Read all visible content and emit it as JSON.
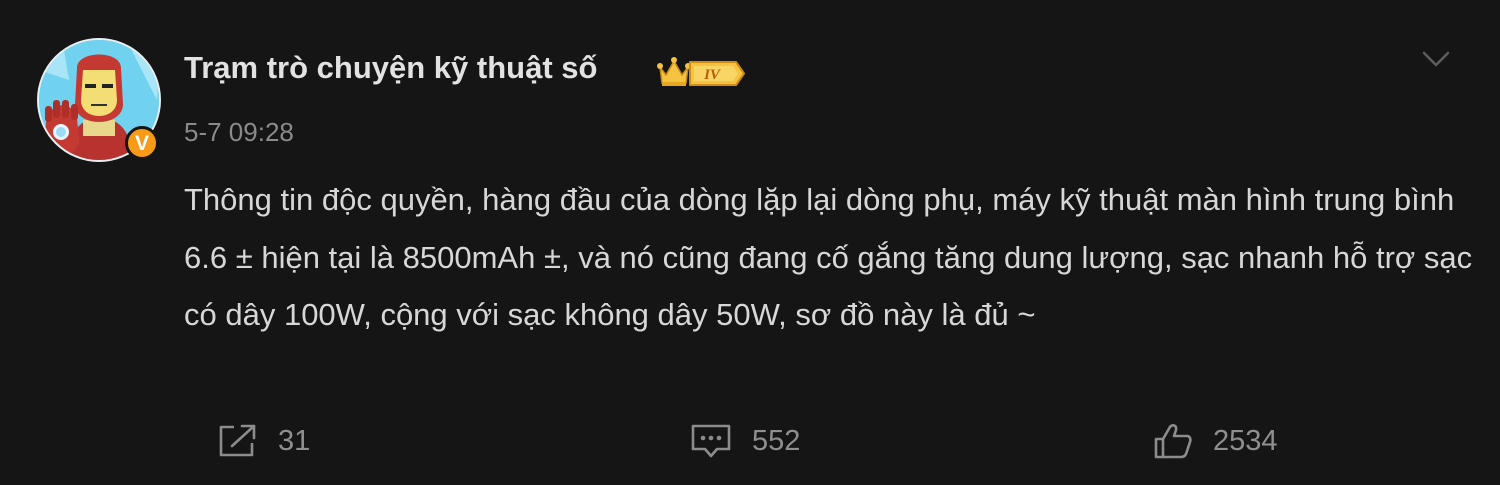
{
  "post": {
    "username": "Trạm trò chuyện kỹ thuật số",
    "level_badge": "IV",
    "timestamp": "5-7 09:28",
    "verified_mark": "V",
    "content": "Thông tin độc quyền, hàng đầu của dòng lặp lại dòng phụ, máy kỹ thuật màn hình trung bình 6.6 ± hiện tại là 8500mAh ±, và nó cũng đang cố gắng tăng dung lượng, sạc nhanh hỗ trợ sạc có dây 100W, cộng với sạc không dây 50W, sơ đồ này là đủ ~"
  },
  "actions": {
    "share_count": "31",
    "comment_count": "552",
    "like_count": "2534"
  },
  "icons": {
    "share": "share-icon",
    "comment": "comment-icon",
    "like": "thumbs-up-icon",
    "menu": "chevron-down-icon",
    "crown": "crown-icon"
  },
  "colors": {
    "background": "#151515",
    "text": "#d7d7d7",
    "muted": "#8a8a8a",
    "verified_badge": "#f79a17",
    "level_badge": "#f5c342"
  }
}
